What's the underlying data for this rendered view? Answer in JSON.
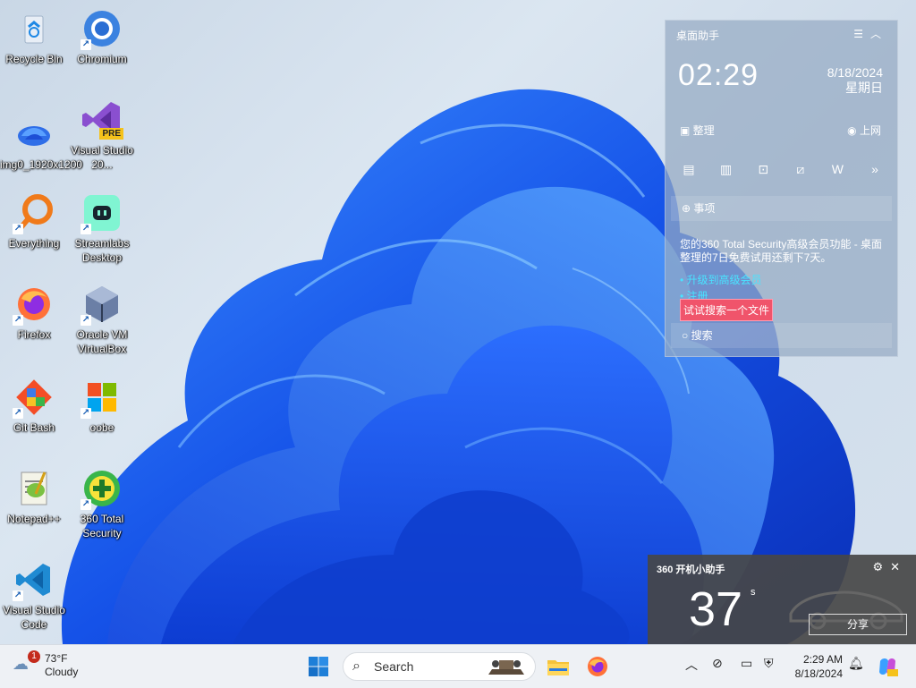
{
  "desktop": {
    "icons": [
      {
        "label": "Recycle Bin"
      },
      {
        "label": "Chromium"
      },
      {
        "label": "img0_1920x1200"
      },
      {
        "label": "Visual Studio 20..."
      },
      {
        "label": "Everything"
      },
      {
        "label": "Streamlabs Desktop"
      },
      {
        "label": "Firefox"
      },
      {
        "label": "Oracle VM VirtualBox"
      },
      {
        "label": "Git Bash"
      },
      {
        "label": "oobe"
      },
      {
        "label": "Notepad++"
      },
      {
        "label": "360 Total Security"
      },
      {
        "label": "Visual Studio Code"
      }
    ],
    "vs_badge": "PRE"
  },
  "helper": {
    "title": "桌面助手",
    "time": "02:29",
    "date": "8/18/2024",
    "weekday": "星期日",
    "organize": "整理",
    "online": "上网",
    "todo": "事项",
    "promo": "您的360 Total Security高级会员功能 - 桌面整理的7日免费试用还剩下7天。",
    "link1": "• 升级到高级会员",
    "link2": "• 注册",
    "tip": "试试搜索一个文件",
    "search": "搜索"
  },
  "boot_helper": {
    "title": "360 开机小助手",
    "seconds": "37",
    "unit": "s",
    "share": "分享"
  },
  "taskbar": {
    "weather_temp": "73°F",
    "weather_desc": "Cloudy",
    "weather_badge": "1",
    "search_placeholder": "Search",
    "time": "2:29 AM",
    "date": "8/18/2024"
  },
  "colors": {
    "accent": "#0f6cbd",
    "bloom": "#1a5ff0",
    "tip_bg": "#f0546b"
  }
}
